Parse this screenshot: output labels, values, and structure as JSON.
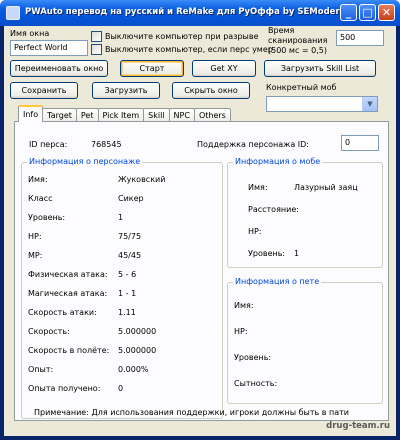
{
  "window": {
    "title": "PWAuto перевод на русский и ReMake для РуОффа by SEModer",
    "minimize": "_",
    "maximize": "□",
    "close": "✕"
  },
  "controls": {
    "window_name_label": "Имя окна",
    "window_name_value": "Perfect World",
    "chk_shutdown_disconnect": "Выключите компьютер при разрыве",
    "chk_shutdown_death": "Выключите компьютер, если перс умер",
    "scan_time_label_1": "Время",
    "scan_time_label_2": "сканирования",
    "scan_time_label_3": "(500 мс = 0,5)",
    "scan_time_value": "500",
    "rename_window_button": "Переименовать окно",
    "start_button": "Старт",
    "get_xy_button": "Get XY",
    "load_skill_list_button": "Загрузить Skill List",
    "save_button": "Сохранить",
    "load_button": "Загрузить",
    "hide_window_button": "Скрыть окно",
    "specific_mob_label": "Конкретный моб",
    "specific_mob_value": ""
  },
  "tabs": [
    "Info",
    "Target",
    "Pet",
    "Pick Item",
    "Skill",
    "NPC",
    "Others"
  ],
  "info": {
    "id_label": "ID перса:",
    "id_value": "768545",
    "support_id_label": "Поддержка персонажа ID:",
    "support_id_value": "0",
    "char_group_title": "Информация о персонаже",
    "char_rows": [
      {
        "label": "Имя:",
        "value": "Жуковский"
      },
      {
        "label": "Класс",
        "value": "Сикер"
      },
      {
        "label": "Уровень:",
        "value": "1"
      },
      {
        "label": "HP:",
        "value": "75/75"
      },
      {
        "label": "MP:",
        "value": "45/45"
      },
      {
        "label": "Физическая атака:",
        "value": "5 - 6"
      },
      {
        "label": "Магическая атака:",
        "value": "1 - 1"
      },
      {
        "label": "Скорость атаки:",
        "value": "1.11"
      },
      {
        "label": "Скорость:",
        "value": "5.000000"
      },
      {
        "label": "Скорость в полёте:",
        "value": "5.000000"
      },
      {
        "label": "Опыт:",
        "value": "0.000%"
      },
      {
        "label": "Опыта получено:",
        "value": "0"
      }
    ],
    "mob_group_title": "Информация о мобе",
    "mob_rows": [
      {
        "label": "Имя:",
        "value": "Лазурный заяц"
      },
      {
        "label": "Расстояние:",
        "value": ""
      },
      {
        "label": "HP:",
        "value": ""
      },
      {
        "label": "Уровень:",
        "value": "1"
      }
    ],
    "pet_group_title": "Информация о пете",
    "pet_rows": [
      {
        "label": "Имя:",
        "value": ""
      },
      {
        "label": "HP:",
        "value": ""
      },
      {
        "label": "Уровень:",
        "value": ""
      },
      {
        "label": "Сытность:",
        "value": ""
      }
    ]
  },
  "note": "Примечание: Для использования поддержки, игроки должны быть в пати",
  "watermark": "drug-team.ru"
}
